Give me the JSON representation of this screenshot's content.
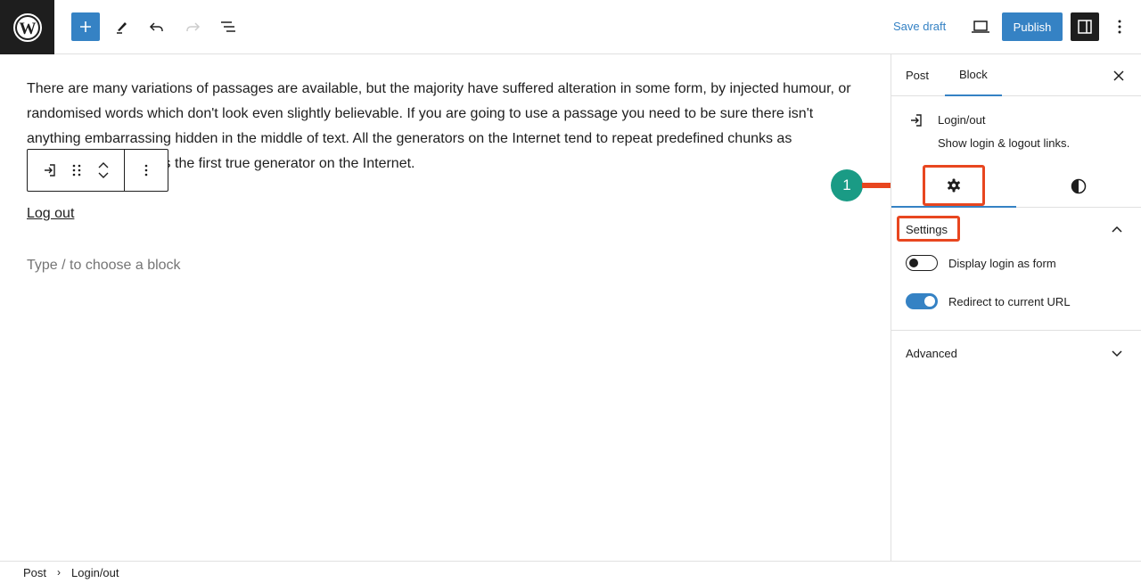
{
  "topbar": {
    "logo": "wordpress-logo",
    "toolbar_icons": [
      "plus-icon",
      "pencil-icon",
      "undo-icon",
      "redo-icon",
      "list-view-icon"
    ],
    "save_draft_label": "Save draft",
    "preview_icon": "laptop-icon",
    "publish_label": "Publish",
    "settings_icon": "sidebar-icon",
    "options_icon": "more-vertical-icon"
  },
  "editor": {
    "paragraph_text": "There are many variations of passages are available, but the majority have suffered alteration in some form, by injected humour, or randomised words which don't look even slightly believable. If you are going to use a passage you need to be sure there isn't anything embarrassing hidden in the middle of text. All the generators on the Internet tend to repeat predefined chunks as necessary, making this the first true generator on the Internet.",
    "block_toolbar": {
      "icons": [
        "login-icon",
        "drag-handle-icon",
        "move-up-icon",
        "move-down-icon",
        "more-options-icon"
      ]
    },
    "logout_link": "Log out",
    "block_placeholder": "Type / to choose a block"
  },
  "sidebar": {
    "tabs": [
      {
        "label": "Post",
        "active": false
      },
      {
        "label": "Block",
        "active": true
      }
    ],
    "close_icon": "close-icon",
    "block_card": {
      "icon": "login-icon",
      "title": "Login/out",
      "description": "Show login & logout links."
    },
    "sub_tabs": [
      {
        "icon": "gear-icon",
        "name": "settings",
        "active": true
      },
      {
        "icon": "contrast-icon",
        "name": "styles",
        "active": false
      }
    ],
    "settings_panel": {
      "title": "Settings",
      "expanded": true,
      "toggles": [
        {
          "label": "Display login as form",
          "checked": false
        },
        {
          "label": "Redirect to current URL",
          "checked": true
        }
      ]
    },
    "advanced_panel": {
      "title": "Advanced",
      "expanded": false
    }
  },
  "footer": {
    "breadcrumbs": [
      "Post",
      "Login/out"
    ]
  },
  "annotation": {
    "step_number": "1",
    "color": "#e8461f",
    "badge_color": "#1a9b85"
  },
  "colors": {
    "accent": "#3582c4",
    "dark": "#1e1e1e",
    "highlight": "#e8461f"
  }
}
